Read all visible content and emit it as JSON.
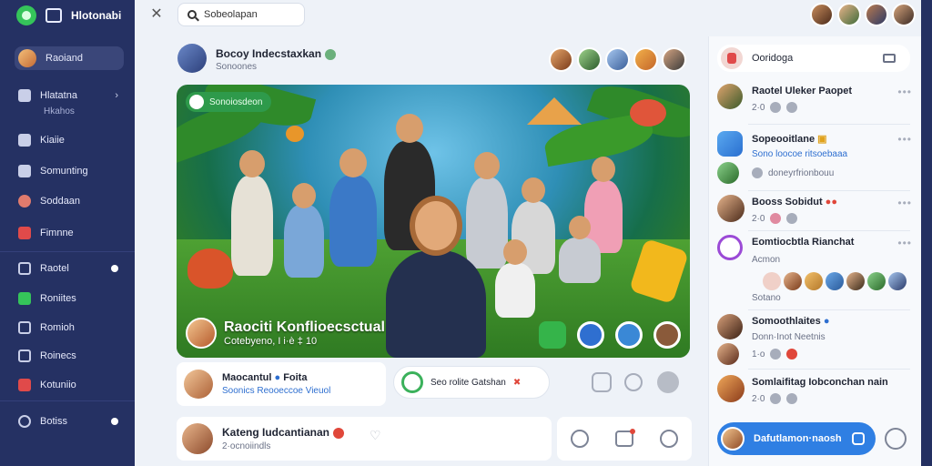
{
  "app": {
    "title": "Hlotonabi"
  },
  "sidebar": {
    "profile_label": "Raoiand",
    "items": [
      {
        "label": "Hlatatna",
        "sub": "Hkahos"
      },
      {
        "label": "Kiaiie"
      },
      {
        "label": "Somunting"
      },
      {
        "label": "Soddaan"
      },
      {
        "label": "Fimnne"
      },
      {
        "label": "Raotel"
      },
      {
        "label": "Roniites"
      },
      {
        "label": "Romioh"
      },
      {
        "label": "Roinecs"
      },
      {
        "label": "Kotuniio"
      },
      {
        "label": "Botiss"
      }
    ]
  },
  "search": {
    "value": "Sobeolapan"
  },
  "post": {
    "author": "Bocoy Indecstaxkan",
    "sub": "Sonoones",
    "badge": "Sonoiosdeon",
    "caption_title": "Raociti Konflioecsctual",
    "caption_sub": "Cotebyeno, I i·è ‡ 10"
  },
  "below_hero": {
    "person_name": "Maocantul",
    "person_name_extra": "Foita",
    "person_sub": "Soonics Reooeccoe Vieuol",
    "pill_text": "Seo rolite Gatshan"
  },
  "comment": {
    "name": "Kateng Iudcantianan",
    "sub": "2·ocnoiindls"
  },
  "right_panel": {
    "groups_label": "Ooridoga",
    "items": [
      {
        "name": "Raotel Uleker Paopet",
        "meta": "2·0"
      },
      {
        "name": "Sopeooitlane",
        "meta": "Sono loocoe ritsoebaaa",
        "meta2": "doneyrfrionbouu"
      },
      {
        "name": "Booss Sobidut",
        "meta": "2·0"
      },
      {
        "name": "Eomtiocbtla Rianchat",
        "meta": "Acmon",
        "meta2": "Sotano"
      },
      {
        "name": "Somoothlaites",
        "meta": "Donn·Inot Neetnis",
        "meta2": "1·o"
      },
      {
        "name": "Somlaifitag Iobconchan nain",
        "meta": "2·0"
      }
    ],
    "join_label": "Dafutlamon·naosh"
  },
  "colors": {
    "accent": "#2f7fe3",
    "sidebar": "#253163",
    "brand_green": "#35c45a"
  }
}
